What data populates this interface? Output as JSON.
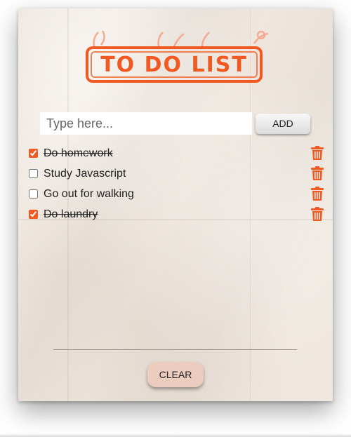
{
  "app": {
    "title": "TO DO LIST",
    "accent_color": "#f05a22"
  },
  "input": {
    "placeholder": "Type here...",
    "value": ""
  },
  "add_button": {
    "label": "ADD"
  },
  "todos": [
    {
      "label": "Do homework",
      "done": true,
      "delete_icon": "trash-icon"
    },
    {
      "label": "Study Javascript",
      "done": false,
      "delete_icon": "trash-icon"
    },
    {
      "label": "Go out for walking",
      "done": false,
      "delete_icon": "trash-icon"
    },
    {
      "label": "Do laundry",
      "done": true,
      "delete_icon": "trash-icon"
    }
  ],
  "clear_button": {
    "label": "CLEAR"
  }
}
